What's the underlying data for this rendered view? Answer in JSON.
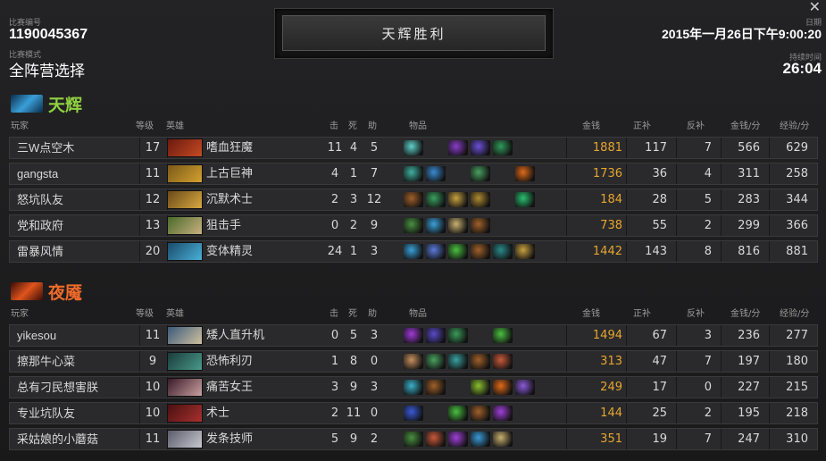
{
  "match": {
    "id_label": "比赛编号",
    "id": "1190045367",
    "mode_label": "比赛模式",
    "mode": "全阵营选择",
    "result": "天辉胜利",
    "date_label": "日期",
    "date": "2015年一月26日下午9:00:20",
    "duration_label": "持续时间",
    "duration": "26:04",
    "close_glyph": "✕"
  },
  "headers": {
    "player": "玩家",
    "level": "等级",
    "hero": "英雄",
    "kills": "击",
    "deaths": "死",
    "assists": "助",
    "items": "物品",
    "gold": "金钱",
    "last_hits": "正补",
    "denies": "反补",
    "gpm": "金钱/分",
    "xpm": "经验/分"
  },
  "colors": {
    "radiant": "#8fd140",
    "dire": "#f06a2a",
    "gold": "#e6a52e"
  },
  "teams": [
    {
      "key": "radiant",
      "name": "天辉",
      "icon": "radiant-team-icon",
      "players": [
        {
          "player": "三W点空木",
          "level": "17",
          "hero": "嗜血狂魔",
          "hero_colors": [
            "#6b1a0e",
            "#c44a24"
          ],
          "kills": "11",
          "deaths": "4",
          "assists": "5",
          "items": [
            "#5fd0c8",
            null,
            "#8a3cc8",
            "#6b4fd8",
            "#2f9a5a",
            null
          ],
          "gold": "1881",
          "last_hits": "117",
          "denies": "7",
          "gpm": "566",
          "xpm": "629"
        },
        {
          "player": "gangsta",
          "level": "11",
          "hero": "上古巨神",
          "hero_colors": [
            "#7a5a1a",
            "#d4a030"
          ],
          "kills": "4",
          "deaths": "1",
          "assists": "7",
          "items": [
            "#3fb0a0",
            "#3a8ad0",
            null,
            "#4aa060",
            null,
            "#e06a1a"
          ],
          "gold": "1736",
          "last_hits": "36",
          "denies": "4",
          "gpm": "311",
          "xpm": "258"
        },
        {
          "player": "怒坑队友",
          "level": "12",
          "hero": "沉默术士",
          "hero_colors": [
            "#6a4a18",
            "#d8a840"
          ],
          "kills": "2",
          "deaths": "3",
          "assists": "12",
          "items": [
            "#a0602a",
            "#3aa060",
            "#c8a040",
            "#b08a30",
            null,
            "#2ac070"
          ],
          "gold": "184",
          "last_hits": "28",
          "denies": "5",
          "gpm": "283",
          "xpm": "344"
        },
        {
          "player": "党和政府",
          "level": "13",
          "hero": "狙击手",
          "hero_colors": [
            "#4a6a2a",
            "#c8b080"
          ],
          "kills": "0",
          "deaths": "2",
          "assists": "9",
          "items": [
            "#4a9040",
            "#3aa0d8",
            "#c8b070",
            "#a0602a",
            null,
            null
          ],
          "gold": "738",
          "last_hits": "55",
          "denies": "2",
          "gpm": "299",
          "xpm": "366"
        },
        {
          "player": "雷暴风情",
          "level": "20",
          "hero": "变体精灵",
          "hero_colors": [
            "#1a4a6a",
            "#4ab0d8"
          ],
          "kills": "24",
          "deaths": "1",
          "assists": "3",
          "items": [
            "#3aa0d8",
            "#5a7ad8",
            "#4ac040",
            "#a0602a",
            "#2a8a8a",
            "#c8a040"
          ],
          "gold": "1442",
          "last_hits": "143",
          "denies": "8",
          "gpm": "816",
          "xpm": "881"
        }
      ]
    },
    {
      "key": "dire",
      "name": "夜魇",
      "icon": "dire-team-icon",
      "players": [
        {
          "player": "yikesou",
          "level": "11",
          "hero": "矮人直升机",
          "hero_colors": [
            "#3a5a7a",
            "#d0c0a0"
          ],
          "kills": "0",
          "deaths": "5",
          "assists": "3",
          "items": [
            "#a03ad8",
            "#5a4ac8",
            "#3a9a5a",
            null,
            "#4ac040",
            null
          ],
          "gold": "1494",
          "last_hits": "67",
          "denies": "3",
          "gpm": "236",
          "xpm": "277"
        },
        {
          "player": "擦那牛心菜",
          "level": "9",
          "hero": "恐怖利刃",
          "hero_colors": [
            "#1a3a3a",
            "#4a9a8a"
          ],
          "kills": "1",
          "deaths": "8",
          "assists": "0",
          "items": [
            "#c89060",
            "#4aa060",
            "#3aa0a0",
            "#a0602a",
            "#c85a3a",
            null
          ],
          "gold": "313",
          "last_hits": "47",
          "denies": "7",
          "gpm": "197",
          "xpm": "180"
        },
        {
          "player": "总有刁民想害朕",
          "level": "10",
          "hero": "痛苦女王",
          "hero_colors": [
            "#3a1a2a",
            "#c8a0a0"
          ],
          "kills": "3",
          "deaths": "9",
          "assists": "3",
          "items": [
            "#3ab0c8",
            "#a0602a",
            null,
            "#8ac030",
            "#e06a1a",
            "#8a5ad8"
          ],
          "gold": "249",
          "last_hits": "17",
          "denies": "0",
          "gpm": "227",
          "xpm": "215"
        },
        {
          "player": "专业坑队友",
          "level": "10",
          "hero": "术士",
          "hero_colors": [
            "#4a1010",
            "#a83030"
          ],
          "kills": "2",
          "deaths": "11",
          "assists": "0",
          "items": [
            "#3a5ad8",
            null,
            "#4ac040",
            "#a0602a",
            "#a040d8",
            null
          ],
          "gold": "144",
          "last_hits": "25",
          "denies": "2",
          "gpm": "195",
          "xpm": "218"
        },
        {
          "player": "采姑娘的小蘑菇",
          "level": "11",
          "hero": "发条技师",
          "hero_colors": [
            "#5a5a6a",
            "#c8c8d0"
          ],
          "kills": "5",
          "deaths": "9",
          "assists": "2",
          "items": [
            "#4a9040",
            "#c85a3a",
            "#a040d8",
            "#3a9ad8",
            "#c8b070",
            null
          ],
          "gold": "351",
          "last_hits": "19",
          "denies": "7",
          "gpm": "247",
          "xpm": "310"
        }
      ]
    }
  ]
}
